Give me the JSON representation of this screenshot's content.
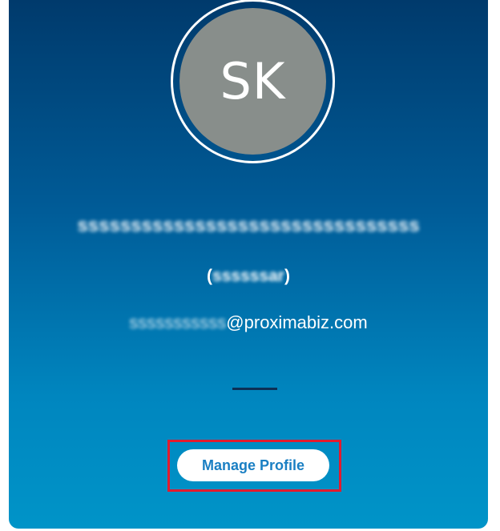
{
  "profile": {
    "initials": "SK",
    "display_name": "ssssssssssssssssssssssssssssssss",
    "username_open": "(",
    "username_masked": "ssssssar",
    "username_close": ")",
    "email_masked": "sssssssssss",
    "email_domain": "@proximabiz.com"
  },
  "actions": {
    "manage_profile_label": "Manage Profile"
  },
  "colors": {
    "card_top": "#003a6c",
    "card_bottom": "#0094c8",
    "avatar_bg": "#888e8b",
    "button_text": "#1a7fc3",
    "highlight": "#e31b2e"
  }
}
